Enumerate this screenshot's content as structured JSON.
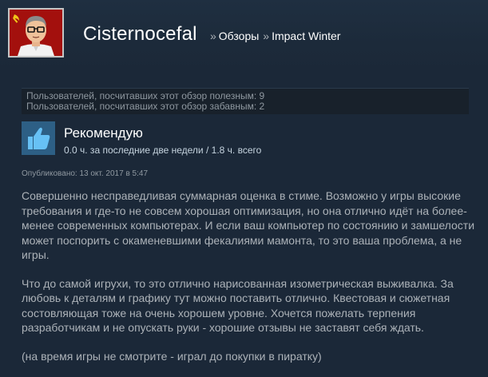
{
  "profile": {
    "persona_name": "Cisternocefal",
    "breadcrumbs": [
      {
        "label": "Обзоры"
      },
      {
        "label": "Impact Winter"
      }
    ],
    "separator": "»"
  },
  "votes": {
    "helpful": "Пользователей, посчитавших этот обзор полезным: 9",
    "funny": "Пользователей, посчитавших этот обзор забавным: 2"
  },
  "review": {
    "verdict": "Рекомендую",
    "hours": "0.0 ч. за последние две недели / 1.8 ч. всего",
    "posted": "Опубликовано: 13 окт. 2017 в 5:47",
    "paragraphs": [
      "Совершенно несправедливая суммарная оценка в стиме. Возможно у игры высокие требования и где-то не совсем хорошая оптимизация, но она отлично идёт на более-менее современных компьютерах. И если ваш компьютер по состоянию и замшелости может поспорить с окаменевшими фекалиями мамонта, то это ваша проблема, а не игры.",
      "Что до самой игрухи, то это отлично нарисованная изометрическая выживалка. За любовь к деталям и графику тут можно поставить отлично. Квестовая и сюжетная состовляющая тоже на очень хорошем уровне. Хочется пожелать терпения разработчикам и не опускать руки - хорошие отзывы не заставят себя ждать.",
      "(на время игры не смотрите - играл до покупки в пиратку)"
    ]
  },
  "icons": {
    "avatar": "avatar-cartoon-man",
    "verdict": "thumbs-up-icon"
  },
  "colors": {
    "background": "#1b2838",
    "thumb_box": "#2d5f85",
    "text": "#acb2b8",
    "avatar_bg": "#a3100d"
  }
}
